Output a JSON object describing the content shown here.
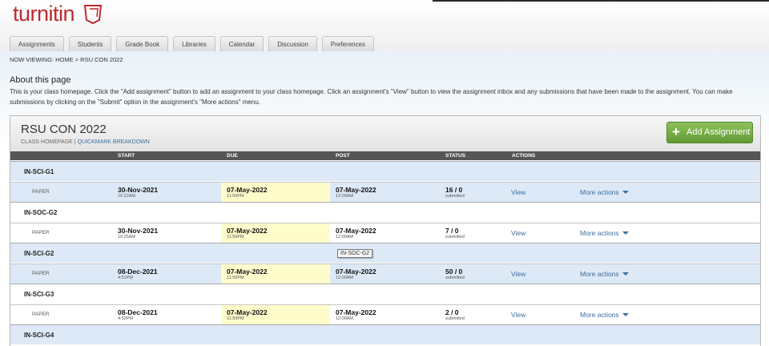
{
  "brand": {
    "name": "turnitin",
    "logo_color": "#c0282e"
  },
  "tabs": [
    "Assignments",
    "Students",
    "Grade Book",
    "Libraries",
    "Calendar",
    "Discussion",
    "Preferences"
  ],
  "breadcrumb": {
    "prefix": "NOW VIEWING:",
    "home": "HOME",
    "sep": ">",
    "current": "RSU CON 2022"
  },
  "about": {
    "title": "About this page",
    "text": "This is your class homepage. Click the \"Add assignment\" button to add an assignment to your class homepage. Click an assignment's \"View\" button to view the assignment inbox and any submissions that have been made to the assignment. You can make submissions by clicking on the \"Submit\" option in the assignment's \"More actions\" menu."
  },
  "class": {
    "title": "RSU CON 2022",
    "link_home": "CLASS HOMEPAGE",
    "link_sep": "|",
    "link_quickmark": "QUICKMARK BREAKDOWN",
    "add_button": "Add Assignment"
  },
  "columns": {
    "start": "START",
    "due": "DUE",
    "post": "POST",
    "status": "STATUS",
    "actions": "ACTIONS"
  },
  "sections": [
    {
      "name": "IN-SCI-G1",
      "type": "PAPER",
      "start_date": "30-Nov-2021",
      "start_time": "10:22AM",
      "due_date": "07-May-2022",
      "due_time": "11:59PM",
      "post_date": "07-May-2022",
      "post_time": "12:00AM",
      "status": "16 / 0",
      "status_label": "submitted",
      "view": "View",
      "more": "More actions"
    },
    {
      "name": "IN-SOC-G2",
      "type": "PAPER",
      "start_date": "30-Nov-2021",
      "start_time": "10:25AM",
      "due_date": "07-May-2022",
      "due_time": "11:59PM",
      "post_date": "07-May-2022",
      "post_time": "12:00AM",
      "status": "7 / 0",
      "status_label": "submitted",
      "view": "View",
      "more": "More actions"
    },
    {
      "name": "IN-SCI-G2",
      "type": "PAPER",
      "start_date": "08-Dec-2021",
      "start_time": "4:51PM",
      "due_date": "07-May-2022",
      "due_time": "11:59PM",
      "post_date": "07-May-2022",
      "post_time": "12:00AM",
      "status": "50 / 0",
      "status_label": "submitted",
      "view": "View",
      "more": "More actions"
    },
    {
      "name": "IN-SCI-G3",
      "type": "PAPER",
      "start_date": "08-Dec-2021",
      "start_time": "4:52PM",
      "due_date": "07-May-2022",
      "due_time": "11:59PM",
      "post_date": "07-May-2022",
      "post_time": "12:00AM",
      "status": "2 / 0",
      "status_label": "submitted",
      "view": "View",
      "more": "More actions"
    },
    {
      "name": "IN-SCI-G4"
    }
  ],
  "tooltip": "IN-SOC-G2",
  "colors": {
    "accent": "#3b6fa0",
    "due_highlight": "#fffccc",
    "section_blue": "#dde9f6",
    "add_green": "#6fa83d"
  }
}
